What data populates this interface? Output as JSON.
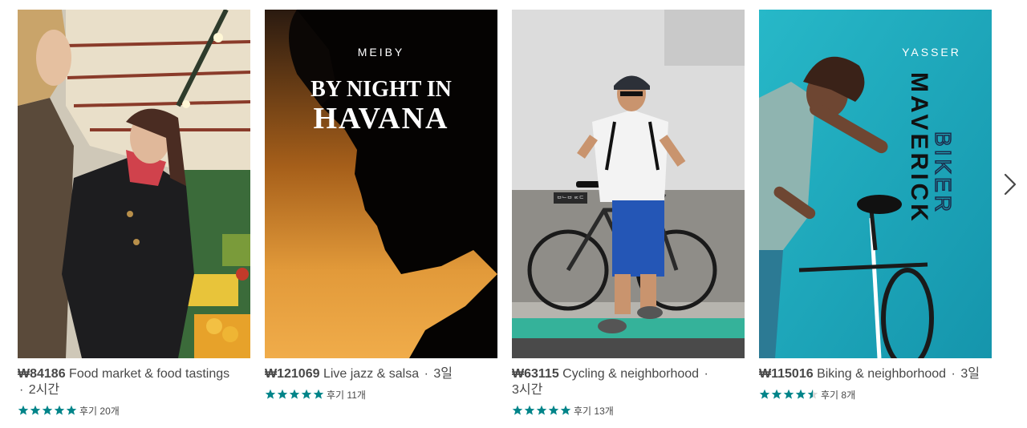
{
  "cards": [
    {
      "price": "₩84186",
      "title": "Food market & food tastings",
      "duration": "2시간",
      "stars": 5,
      "review_label": "후기 20개"
    },
    {
      "price": "₩121069",
      "title": "Live jazz & salsa",
      "duration": "3일",
      "stars": 5,
      "review_label": "후기 11개",
      "poster": {
        "host": "MEIBY",
        "line1": "BY NIGHT IN",
        "line2": "HAVANA"
      }
    },
    {
      "price": "₩63115",
      "title": "Cycling & neighborhood",
      "duration": "3시간",
      "stars": 5,
      "review_label": "후기 13개",
      "sign_text": "ᄇᄂᄇ ᄆᄃᄃ"
    },
    {
      "price": "₩115016",
      "title": "Biking & neighborhood",
      "duration": "3일",
      "stars": 4.5,
      "review_label": "후기 8개",
      "poster": {
        "host": "YASSER",
        "word1": "MAVERICK",
        "word2": "BIKER"
      }
    }
  ],
  "colors": {
    "star": "#008489",
    "text": "#484848",
    "teal_bg": "#1ba9bd"
  },
  "nav": {
    "next_icon": "chevron-right-icon"
  }
}
